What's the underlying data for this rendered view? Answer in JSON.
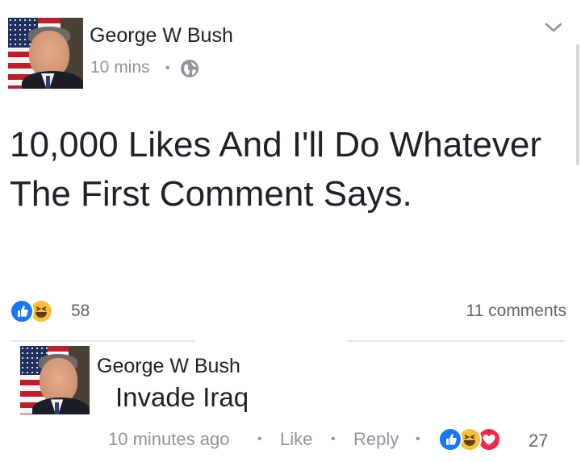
{
  "post": {
    "author": "George W Bush",
    "time": "10 mins",
    "separator": "•",
    "privacy_icon": "globe-icon",
    "text": "10,000 Likes And I'll Do Whatever The First Comment Says.",
    "menu_icon": "chevron-down-icon",
    "reactions": {
      "icons": [
        "like-icon",
        "haha-icon"
      ],
      "count": "58"
    },
    "comments_count": "11 comments"
  },
  "comment": {
    "author": "George W Bush",
    "text": "Invade Iraq",
    "time": "10 minutes ago",
    "like_label": "Like",
    "reply_label": "Reply",
    "separator": "•",
    "reactions": {
      "icons": [
        "like-icon",
        "haha-icon",
        "love-icon"
      ],
      "count": "27"
    }
  },
  "colors": {
    "like": "#1877f2",
    "haha": "#f7c03c",
    "love": "#f0284a",
    "meta_text": "#90949c"
  }
}
